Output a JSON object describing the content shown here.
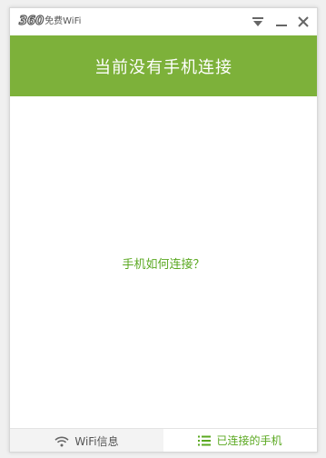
{
  "titlebar": {
    "logo_number": "360",
    "logo_text": "免费WiFi"
  },
  "banner": {
    "title": "当前没有手机连接"
  },
  "content": {
    "help_link": "手机如何连接？"
  },
  "tabs": [
    {
      "label": "WiFi信息",
      "icon": "wifi-icon",
      "active": false
    },
    {
      "label": "已连接的手机",
      "icon": "list-icon",
      "active": true
    }
  ],
  "colors": {
    "accent": "#7db13a",
    "link": "#5aa820"
  }
}
